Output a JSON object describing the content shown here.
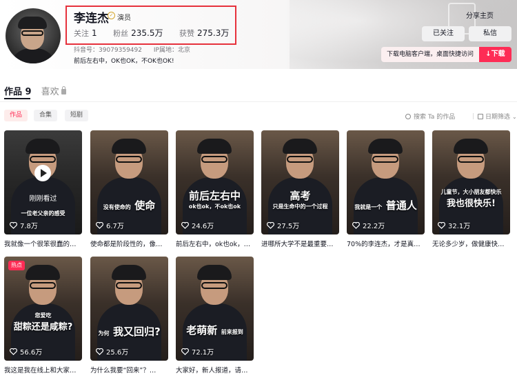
{
  "profile": {
    "name": "李连杰",
    "role": "演员",
    "follow_label": "关注",
    "follow_count": "1",
    "fans_label": "粉丝",
    "fans_count": "235.5万",
    "likes_label": "获赞",
    "likes_count": "275.3万",
    "douyin_id": "抖音号：39079359492",
    "ip_location": "IP属地：北京",
    "bio": "前后左右中，OK也OK，不OK也OK!"
  },
  "header_actions": {
    "share": "分享主页",
    "followed": "已关注",
    "message": "私信",
    "download_tip": "下载电脑客户端，桌面快捷访问",
    "download": "↓下载"
  },
  "tabs": [
    {
      "label": "作品 9"
    },
    {
      "label": "喜欢"
    }
  ],
  "filters": {
    "chips": [
      "作品",
      "合集",
      "短剧"
    ],
    "search": "搜索 Ta 的作品",
    "date_filter": "日期筛选"
  },
  "videos": [
    {
      "caption_small": "一位老父亲的感受",
      "caption_big": "",
      "watched": "刚刚看过",
      "likes": "7.8万",
      "title": "我就像一个很笨很蠢的…",
      "hot": ""
    },
    {
      "caption_small": "没有使命的",
      "caption_big": "使命",
      "watched": "",
      "likes": "6.7万",
      "title": "使命都是阶段性的，像…",
      "hot": ""
    },
    {
      "caption_small": "ok也ok，不ok也ok",
      "caption_big": "前后左右中",
      "watched": "",
      "likes": "24.6万",
      "title": "前后左右中，ok也ok，…",
      "hot": ""
    },
    {
      "caption_small": "只是生命中的一个过程",
      "caption_big": "高考",
      "watched": "",
      "likes": "27.5万",
      "title": "进哪所大学不是最重要…",
      "hot": ""
    },
    {
      "caption_small": "我就是一个",
      "caption_big": "普通人",
      "watched": "",
      "likes": "22.2万",
      "title": "70%的李连杰，才是真…",
      "hot": ""
    },
    {
      "caption_small": "儿童节，大小朋友都快乐",
      "caption_big": "我也很快乐!",
      "watched": "",
      "likes": "32.1万",
      "title": "无论多少岁，做健康快…",
      "hot": ""
    },
    {
      "caption_small": "您爱吃",
      "caption_big": "甜粽还是咸粽?",
      "watched": "",
      "likes": "56.6万",
      "title": "我这是我在线上和大家过…",
      "hot": "热点"
    },
    {
      "caption_small": "为何",
      "caption_big": "我又回归?",
      "watched": "",
      "likes": "25.6万",
      "title": "为什么我要“回来”？…",
      "hot": ""
    },
    {
      "caption_small": "前来报到",
      "caption_big": "老萌新",
      "watched": "",
      "likes": "72.1万",
      "title": "大家好，新人报道，请…",
      "hot": ""
    }
  ],
  "colors": {
    "accent": "#fe2c55",
    "highlight_box": "#e6303b",
    "verify": "#d4a62c"
  }
}
